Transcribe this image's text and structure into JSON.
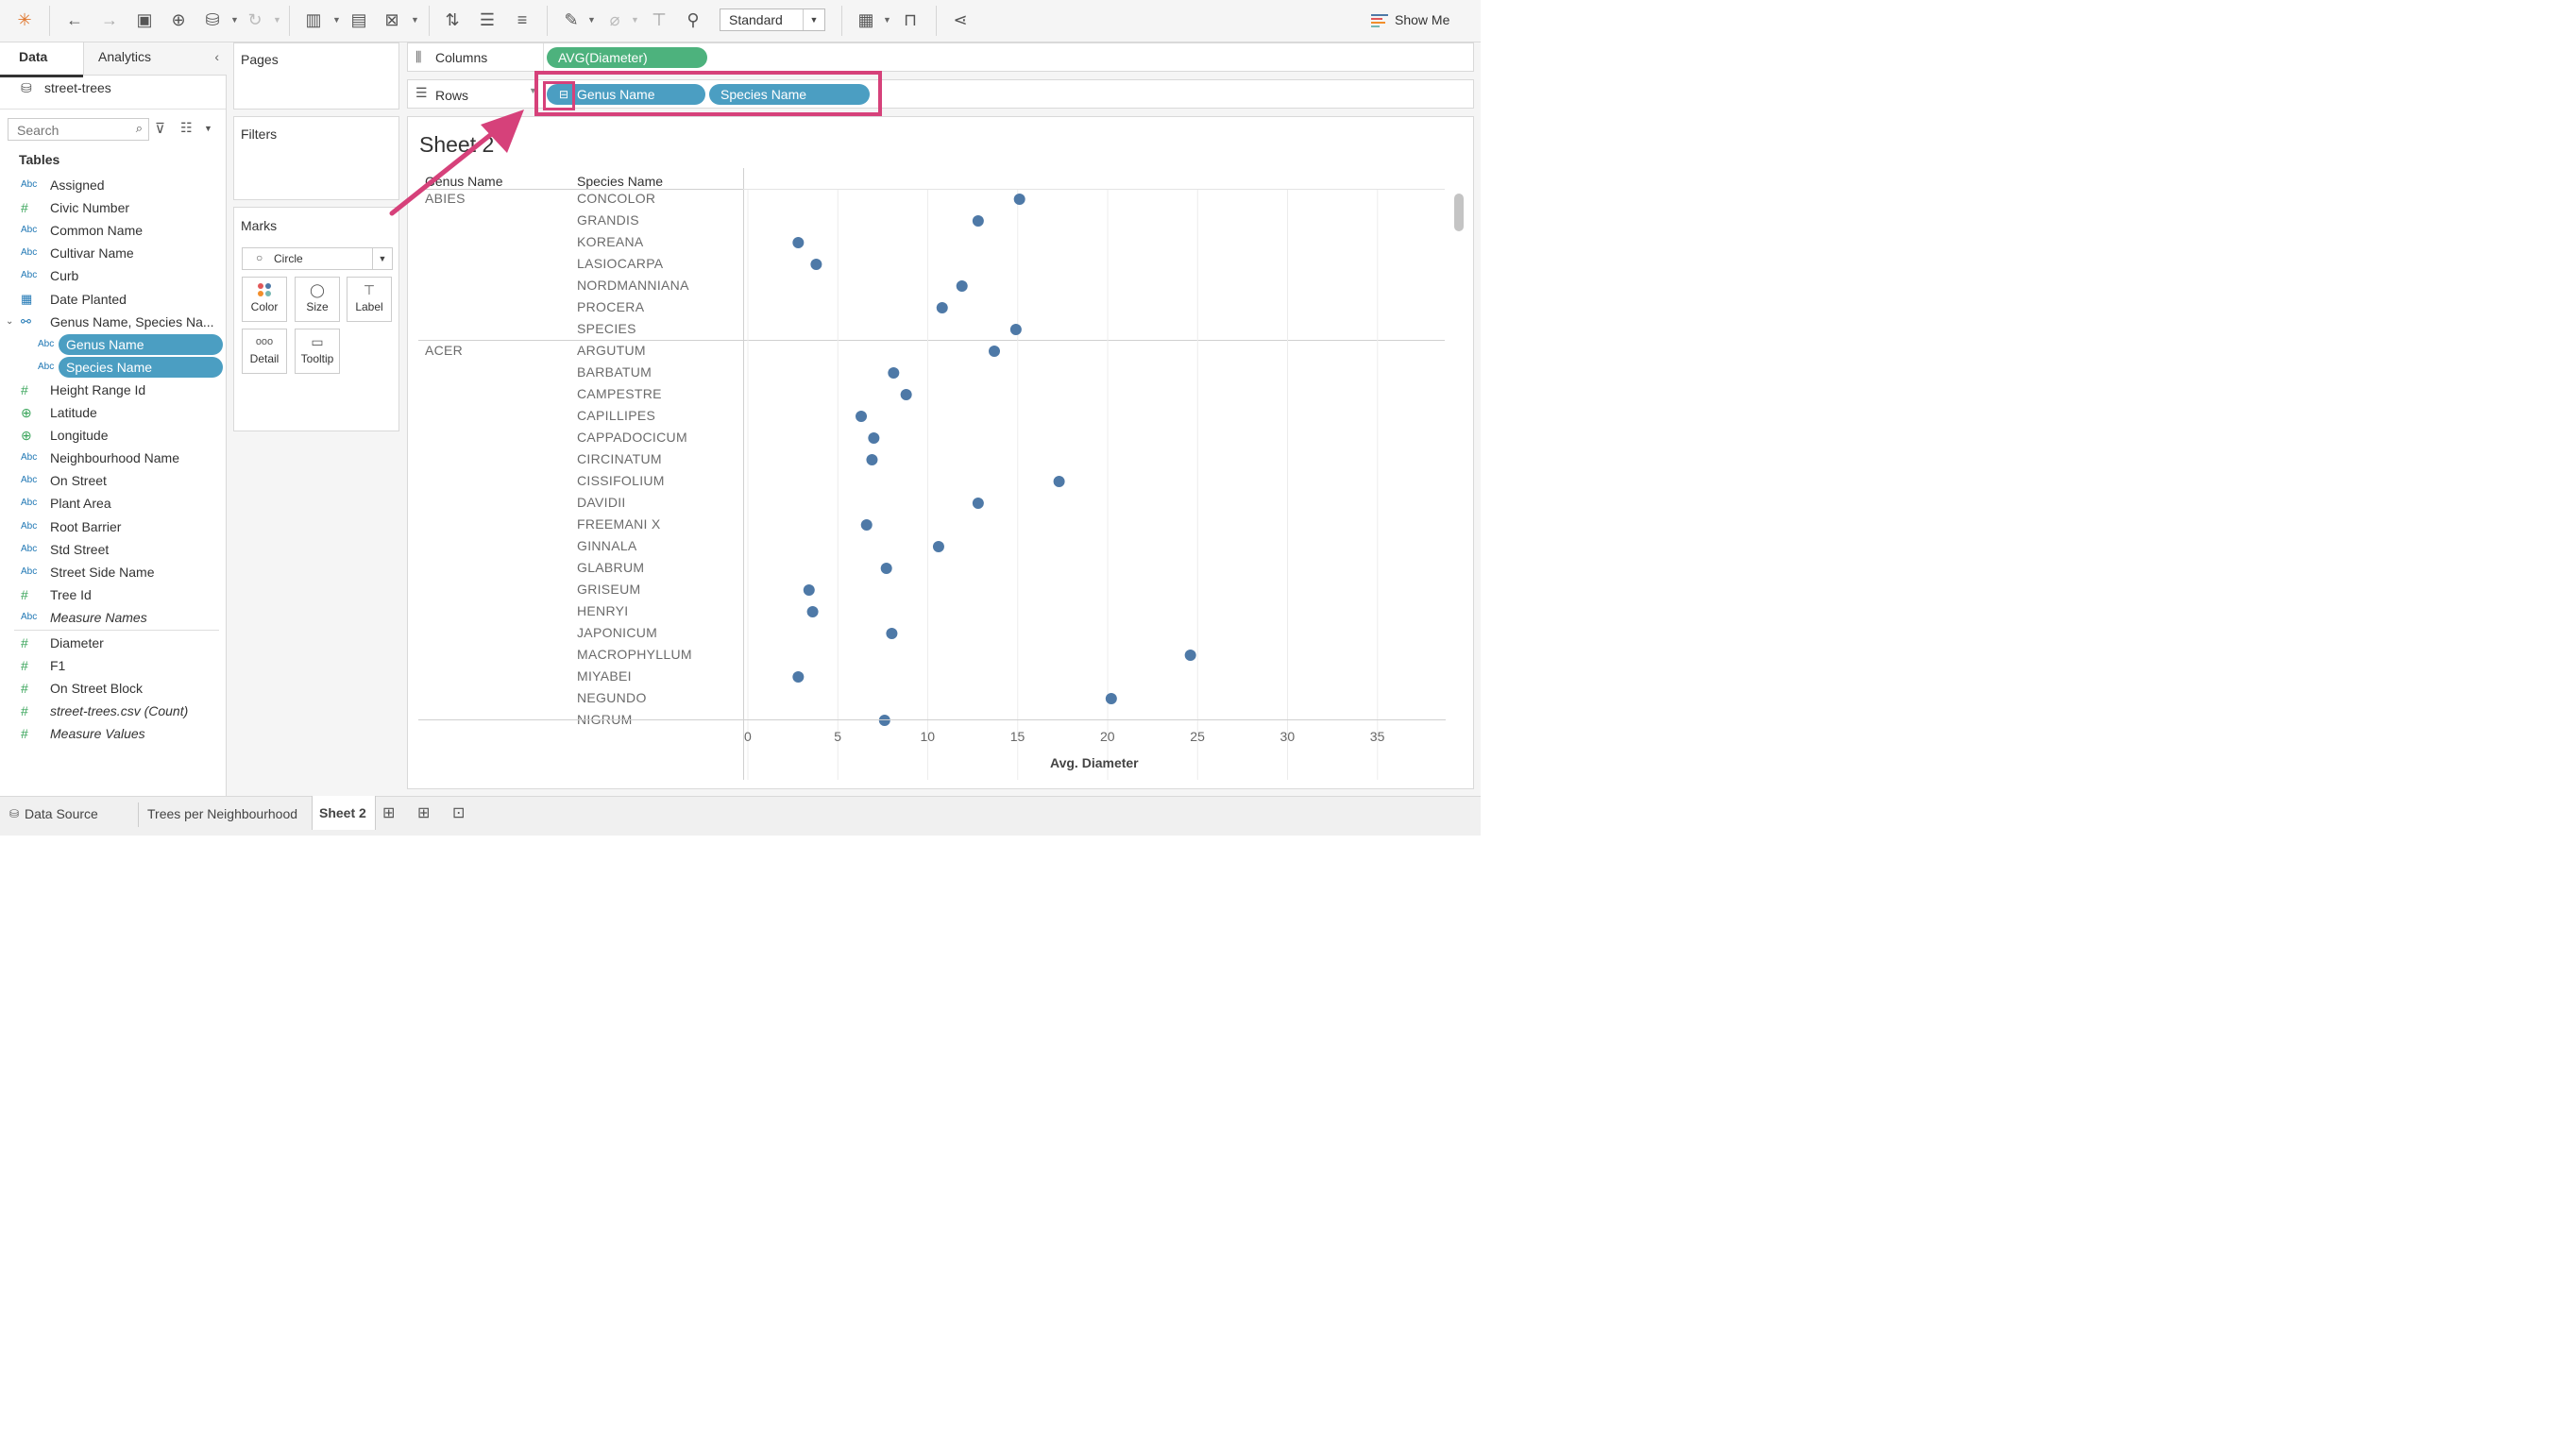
{
  "toolbar": {
    "mode_select": "Standard",
    "show_me": "Show Me",
    "icons": [
      "tableau-logo-icon",
      "undo-icon",
      "redo-icon",
      "save-icon",
      "new-datasource-icon",
      "pause-updates-icon",
      "refresh-icon",
      "new-worksheet-icon",
      "duplicate-sheet-icon",
      "clear-sheet-icon",
      "swap-icon",
      "sort-asc-icon",
      "sort-desc-icon",
      "highlight-icon",
      "group-icon",
      "label-icon",
      "pin-icon",
      "fit-icon",
      "presentation-icon",
      "share-icon"
    ]
  },
  "data_panel": {
    "tab_data": "Data",
    "tab_analytics": "Analytics",
    "datasource": "street-trees",
    "search_placeholder": "Search",
    "tables_heading": "Tables",
    "fields": [
      {
        "type": "Abc",
        "name": "Assigned"
      },
      {
        "type": "#",
        "name": "Civic Number"
      },
      {
        "type": "Abc",
        "name": "Common Name"
      },
      {
        "type": "Abc",
        "name": "Cultivar Name"
      },
      {
        "type": "Abc",
        "name": "Curb"
      },
      {
        "type": "date",
        "name": "Date Planted"
      },
      {
        "type": "hier",
        "name": "Genus Name, Species Na..."
      },
      {
        "type": "Abc",
        "name": "Genus Name"
      },
      {
        "type": "Abc",
        "name": "Species Name"
      },
      {
        "type": "#",
        "name": "Height Range Id"
      },
      {
        "type": "geo",
        "name": "Latitude"
      },
      {
        "type": "geo",
        "name": "Longitude"
      },
      {
        "type": "Abc",
        "name": "Neighbourhood Name"
      },
      {
        "type": "Abc",
        "name": "On Street"
      },
      {
        "type": "Abc",
        "name": "Plant Area"
      },
      {
        "type": "Abc",
        "name": "Root Barrier"
      },
      {
        "type": "Abc",
        "name": "Std Street"
      },
      {
        "type": "Abc",
        "name": "Street Side Name"
      },
      {
        "type": "#",
        "name": "Tree Id"
      },
      {
        "type": "Abc",
        "name": "Measure Names"
      }
    ],
    "measures": [
      {
        "type": "#",
        "name": "Diameter"
      },
      {
        "type": "#",
        "name": "F1"
      },
      {
        "type": "#",
        "name": "On Street Block"
      },
      {
        "type": "#",
        "name": "street-trees.csv (Count)"
      },
      {
        "type": "#",
        "name": "Measure Values"
      }
    ]
  },
  "cards": {
    "pages": "Pages",
    "filters": "Filters",
    "marks": "Marks",
    "mark_type": "Circle",
    "mark_buttons": [
      "Color",
      "Size",
      "Label",
      "Detail",
      "Tooltip"
    ]
  },
  "shelves": {
    "columns_label": "Columns",
    "rows_label": "Rows",
    "columns_pill": "AVG(Diameter)",
    "rows_pills": [
      "Genus Name",
      "Species Name"
    ]
  },
  "sheet": {
    "title": "Sheet 2",
    "col_header_genus": "Genus Name",
    "col_header_species": "Species Name",
    "cut_row": "CONCOLOR",
    "genus_groups": [
      {
        "name": "ABIES"
      },
      {
        "name": "ACER"
      }
    ]
  },
  "chart_data": {
    "type": "scatter",
    "xlabel": "Avg. Diameter",
    "xlim": [
      0,
      39
    ],
    "x_ticks": [
      0,
      5,
      10,
      15,
      20,
      25,
      30,
      35
    ],
    "rows": [
      {
        "genus": "ABIES",
        "species": "CONCOLOR",
        "value": 15.1
      },
      {
        "genus": "ABIES",
        "species": "GRANDIS",
        "value": 12.8
      },
      {
        "genus": "ABIES",
        "species": "KOREANA",
        "value": 2.8
      },
      {
        "genus": "ABIES",
        "species": "LASIOCARPA",
        "value": 3.8
      },
      {
        "genus": "ABIES",
        "species": "NORDMANNIANA",
        "value": 11.9
      },
      {
        "genus": "ABIES",
        "species": "PROCERA",
        "value": 10.8
      },
      {
        "genus": "ABIES",
        "species": "SPECIES",
        "value": 14.9
      },
      {
        "genus": "ACER",
        "species": "ARGUTUM",
        "value": 13.7
      },
      {
        "genus": "ACER",
        "species": "BARBATUM",
        "value": 8.1
      },
      {
        "genus": "ACER",
        "species": "CAMPESTRE",
        "value": 8.8
      },
      {
        "genus": "ACER",
        "species": "CAPILLIPES",
        "value": 6.3
      },
      {
        "genus": "ACER",
        "species": "CAPPADOCICUM",
        "value": 7.0
      },
      {
        "genus": "ACER",
        "species": "CIRCINATUM",
        "value": 6.9
      },
      {
        "genus": "ACER",
        "species": "CISSIFOLIUM",
        "value": 17.3
      },
      {
        "genus": "ACER",
        "species": "DAVIDII",
        "value": 12.8
      },
      {
        "genus": "ACER",
        "species": "FREEMANI   X",
        "value": 6.6
      },
      {
        "genus": "ACER",
        "species": "GINNALA",
        "value": 10.6
      },
      {
        "genus": "ACER",
        "species": "GLABRUM",
        "value": 7.7
      },
      {
        "genus": "ACER",
        "species": "GRISEUM",
        "value": 3.4
      },
      {
        "genus": "ACER",
        "species": "HENRYI",
        "value": 3.6
      },
      {
        "genus": "ACER",
        "species": "JAPONICUM",
        "value": 8.0
      },
      {
        "genus": "ACER",
        "species": "MACROPHYLLUM",
        "value": 24.6
      },
      {
        "genus": "ACER",
        "species": "MIYABEI",
        "value": 2.8
      },
      {
        "genus": "ACER",
        "species": "NEGUNDO",
        "value": 20.2
      },
      {
        "genus": "ACER",
        "species": "NIGRUM",
        "value": 7.6
      }
    ]
  },
  "bottom_tabs": {
    "data_source": "Data Source",
    "tabs": [
      "Trees per Neighbourhood",
      "Sheet 2"
    ],
    "active": "Sheet 2"
  },
  "colors": {
    "dot": "#4e79a7",
    "measure_pill": "#4db27d",
    "dimension_pill": "#4b9ec2",
    "highlight_box": "#d6417a"
  }
}
